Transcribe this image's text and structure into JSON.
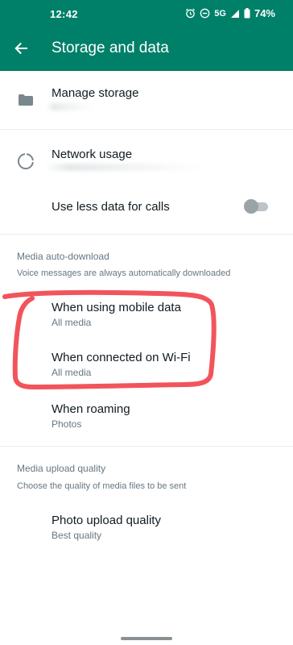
{
  "status_bar": {
    "time": "12:42",
    "network": "5G",
    "battery": "74%",
    "icons": [
      "alarm-icon",
      "dnd-icon",
      "signal-icon",
      "battery-icon"
    ]
  },
  "header": {
    "title": "Storage and data",
    "back_icon": "arrow-left-icon",
    "background_color": "#008069"
  },
  "storage_section": {
    "manage_storage": {
      "label": "Manage storage",
      "icon": "folder-icon"
    },
    "network_usage": {
      "label": "Network usage",
      "icon": "data-usage-icon"
    },
    "use_less_data": {
      "label": "Use less data for calls",
      "enabled": false
    }
  },
  "media_auto_download": {
    "title": "Media auto-download",
    "description": "Voice messages are always automatically downloaded",
    "items": [
      {
        "label": "When using mobile data",
        "value": "All media"
      },
      {
        "label": "When connected on Wi-Fi",
        "value": "All media"
      },
      {
        "label": "When roaming",
        "value": "Photos"
      }
    ]
  },
  "media_upload_quality": {
    "title": "Media upload quality",
    "description": "Choose the quality of media files to be sent",
    "photo_upload": {
      "label": "Photo upload quality",
      "value": "Best quality"
    }
  },
  "colors": {
    "accent": "#008069",
    "annotation": "#f2545b"
  }
}
